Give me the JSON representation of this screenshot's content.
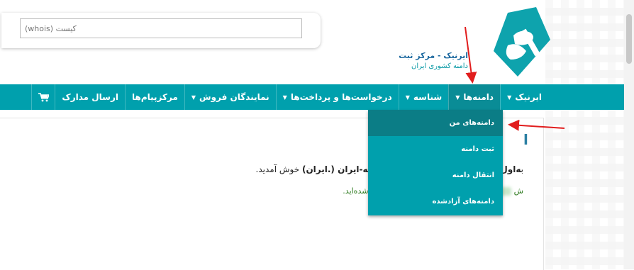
{
  "search": {
    "placeholder": "کیست (whois)"
  },
  "logo": {
    "line1": "ایرنیک - مرکز ثبت",
    "line2": "دامنه کشوری ایران"
  },
  "nav": {
    "items": [
      {
        "label": "ایرنیک",
        "caret": true
      },
      {
        "label": "دامنه‌ها",
        "caret": true
      },
      {
        "label": "شناسه",
        "caret": true
      },
      {
        "label": "درخواست‌ها و پرداخت‌ها",
        "caret": true
      },
      {
        "label": "نمایندگان فروش",
        "caret": true
      },
      {
        "label": "مرکز‌پیام‌ها",
        "caret": false
      },
      {
        "label": "ارسال مدارک",
        "caret": false
      }
    ],
    "cart_icon": "cart-icon"
  },
  "dropdown": {
    "items": [
      {
        "label": "دامنه‌های من"
      },
      {
        "label": "ثبت دامنه"
      },
      {
        "label": "انتقال دامنه"
      },
      {
        "label": "دامنه‌های آزادشده"
      }
    ]
  },
  "content": {
    "title_fragment": "ا",
    "line1_prefix": "ب",
    "line1_bold": "ه‌اول کشوری نقطه-آی‌آر (.ir) و نقطه-ایران (.ایران)",
    "line1_suffix": " خوش آمدید.",
    "line2_prefix": "ش",
    "line2_mid": "za",
    "line2_suffix": "ه سامانه وارد شده‌اید."
  },
  "colors": {
    "nav": "#00a0ad",
    "nav_active": "#0a8c96",
    "dropdown_active": "#0b7d86",
    "arrow": "#e11d1d"
  }
}
